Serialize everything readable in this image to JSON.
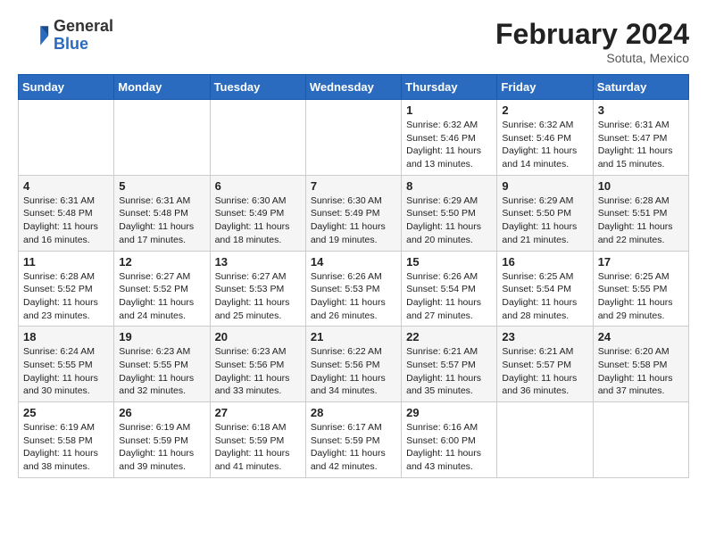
{
  "header": {
    "logo_general": "General",
    "logo_blue": "Blue",
    "month_year": "February 2024",
    "location": "Sotuta, Mexico"
  },
  "weekdays": [
    "Sunday",
    "Monday",
    "Tuesday",
    "Wednesday",
    "Thursday",
    "Friday",
    "Saturday"
  ],
  "weeks": [
    [
      {
        "day": "",
        "info": ""
      },
      {
        "day": "",
        "info": ""
      },
      {
        "day": "",
        "info": ""
      },
      {
        "day": "",
        "info": ""
      },
      {
        "day": "1",
        "info": "Sunrise: 6:32 AM\nSunset: 5:46 PM\nDaylight: 11 hours and 13 minutes."
      },
      {
        "day": "2",
        "info": "Sunrise: 6:32 AM\nSunset: 5:46 PM\nDaylight: 11 hours and 14 minutes."
      },
      {
        "day": "3",
        "info": "Sunrise: 6:31 AM\nSunset: 5:47 PM\nDaylight: 11 hours and 15 minutes."
      }
    ],
    [
      {
        "day": "4",
        "info": "Sunrise: 6:31 AM\nSunset: 5:48 PM\nDaylight: 11 hours and 16 minutes."
      },
      {
        "day": "5",
        "info": "Sunrise: 6:31 AM\nSunset: 5:48 PM\nDaylight: 11 hours and 17 minutes."
      },
      {
        "day": "6",
        "info": "Sunrise: 6:30 AM\nSunset: 5:49 PM\nDaylight: 11 hours and 18 minutes."
      },
      {
        "day": "7",
        "info": "Sunrise: 6:30 AM\nSunset: 5:49 PM\nDaylight: 11 hours and 19 minutes."
      },
      {
        "day": "8",
        "info": "Sunrise: 6:29 AM\nSunset: 5:50 PM\nDaylight: 11 hours and 20 minutes."
      },
      {
        "day": "9",
        "info": "Sunrise: 6:29 AM\nSunset: 5:50 PM\nDaylight: 11 hours and 21 minutes."
      },
      {
        "day": "10",
        "info": "Sunrise: 6:28 AM\nSunset: 5:51 PM\nDaylight: 11 hours and 22 minutes."
      }
    ],
    [
      {
        "day": "11",
        "info": "Sunrise: 6:28 AM\nSunset: 5:52 PM\nDaylight: 11 hours and 23 minutes."
      },
      {
        "day": "12",
        "info": "Sunrise: 6:27 AM\nSunset: 5:52 PM\nDaylight: 11 hours and 24 minutes."
      },
      {
        "day": "13",
        "info": "Sunrise: 6:27 AM\nSunset: 5:53 PM\nDaylight: 11 hours and 25 minutes."
      },
      {
        "day": "14",
        "info": "Sunrise: 6:26 AM\nSunset: 5:53 PM\nDaylight: 11 hours and 26 minutes."
      },
      {
        "day": "15",
        "info": "Sunrise: 6:26 AM\nSunset: 5:54 PM\nDaylight: 11 hours and 27 minutes."
      },
      {
        "day": "16",
        "info": "Sunrise: 6:25 AM\nSunset: 5:54 PM\nDaylight: 11 hours and 28 minutes."
      },
      {
        "day": "17",
        "info": "Sunrise: 6:25 AM\nSunset: 5:55 PM\nDaylight: 11 hours and 29 minutes."
      }
    ],
    [
      {
        "day": "18",
        "info": "Sunrise: 6:24 AM\nSunset: 5:55 PM\nDaylight: 11 hours and 30 minutes."
      },
      {
        "day": "19",
        "info": "Sunrise: 6:23 AM\nSunset: 5:55 PM\nDaylight: 11 hours and 32 minutes."
      },
      {
        "day": "20",
        "info": "Sunrise: 6:23 AM\nSunset: 5:56 PM\nDaylight: 11 hours and 33 minutes."
      },
      {
        "day": "21",
        "info": "Sunrise: 6:22 AM\nSunset: 5:56 PM\nDaylight: 11 hours and 34 minutes."
      },
      {
        "day": "22",
        "info": "Sunrise: 6:21 AM\nSunset: 5:57 PM\nDaylight: 11 hours and 35 minutes."
      },
      {
        "day": "23",
        "info": "Sunrise: 6:21 AM\nSunset: 5:57 PM\nDaylight: 11 hours and 36 minutes."
      },
      {
        "day": "24",
        "info": "Sunrise: 6:20 AM\nSunset: 5:58 PM\nDaylight: 11 hours and 37 minutes."
      }
    ],
    [
      {
        "day": "25",
        "info": "Sunrise: 6:19 AM\nSunset: 5:58 PM\nDaylight: 11 hours and 38 minutes."
      },
      {
        "day": "26",
        "info": "Sunrise: 6:19 AM\nSunset: 5:59 PM\nDaylight: 11 hours and 39 minutes."
      },
      {
        "day": "27",
        "info": "Sunrise: 6:18 AM\nSunset: 5:59 PM\nDaylight: 11 hours and 41 minutes."
      },
      {
        "day": "28",
        "info": "Sunrise: 6:17 AM\nSunset: 5:59 PM\nDaylight: 11 hours and 42 minutes."
      },
      {
        "day": "29",
        "info": "Sunrise: 6:16 AM\nSunset: 6:00 PM\nDaylight: 11 hours and 43 minutes."
      },
      {
        "day": "",
        "info": ""
      },
      {
        "day": "",
        "info": ""
      }
    ]
  ]
}
